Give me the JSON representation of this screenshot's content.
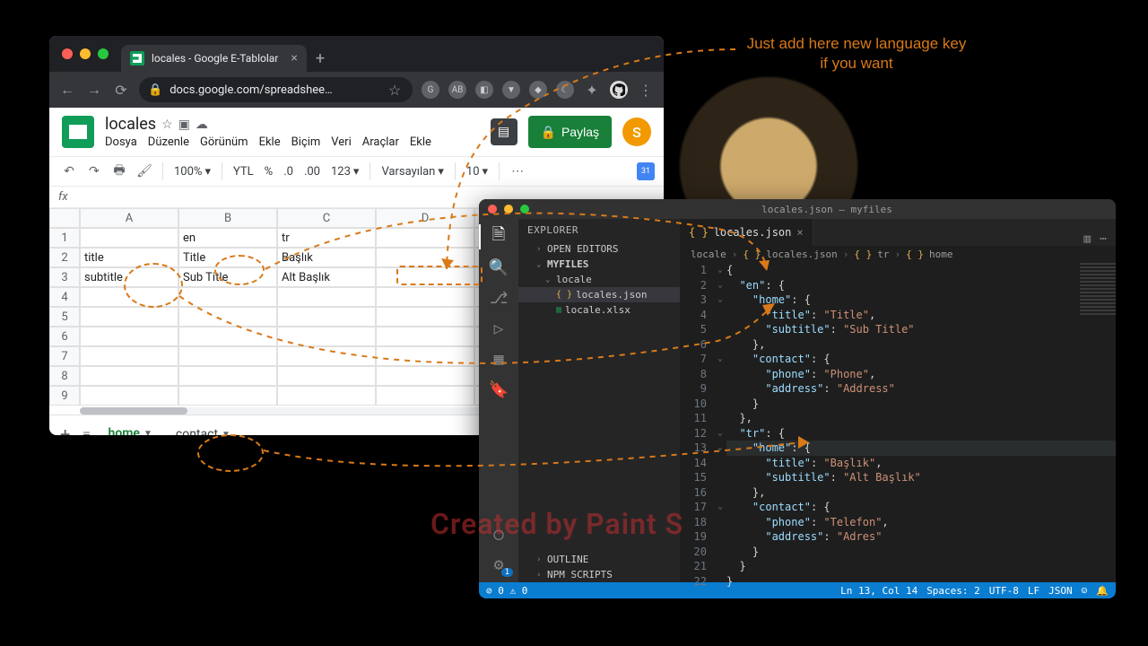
{
  "annotation": {
    "line1": "Just add here new language key",
    "line2": "if you want"
  },
  "watermark": "Created by Paint S",
  "chrome": {
    "tab_title": "locales - Google E-Tablolar",
    "url": "docs.google.com/spreadshee…"
  },
  "sheets": {
    "doc_title": "locales",
    "menus": [
      "Dosya",
      "Düzenle",
      "Görünüm",
      "Ekle",
      "Biçim",
      "Veri",
      "Araçlar",
      "Ekle"
    ],
    "share_label": "Paylaş",
    "avatar_letter": "S",
    "toolbar": {
      "zoom": "100%",
      "currency": "YTL",
      "percent": "%",
      "dec_dec": ".0",
      "dec_inc": ".00",
      "numfmt": "123",
      "font": "Varsayılan",
      "size": "10"
    },
    "columns": [
      "A",
      "B",
      "C",
      "D"
    ],
    "rows": [
      "1",
      "2",
      "3",
      "4",
      "5",
      "6",
      "7",
      "8",
      "9"
    ],
    "data": [
      [
        "",
        "en",
        "tr",
        ""
      ],
      [
        "title",
        "Title",
        "Başlık",
        ""
      ],
      [
        "subtitle",
        "Sub Title",
        "Alt Başlık",
        ""
      ]
    ],
    "tabs": {
      "active": "home",
      "other": "contact"
    },
    "cal_day": "31"
  },
  "vscode": {
    "title": "locales.json — myfiles",
    "explorer": {
      "header": "EXPLORER",
      "open_editors": "OPEN EDITORS",
      "workspace": "MYFILES",
      "folder": "locale",
      "file_json": "locales.json",
      "file_xlsx": "locale.xlsx",
      "outline": "OUTLINE",
      "npm": "NPM SCRIPTS"
    },
    "tab": "locales.json",
    "breadcrumbs": [
      "locale",
      "locales.json",
      "tr",
      "home"
    ],
    "code_lines": [
      "{",
      "  \"en\": {",
      "    \"home\": {",
      "      \"title\": \"Title\",",
      "      \"subtitle\": \"Sub Title\"",
      "    },",
      "    \"contact\": {",
      "      \"phone\": \"Phone\",",
      "      \"address\": \"Address\"",
      "    }",
      "  },",
      "  \"tr\": {",
      "    \"home\": {",
      "      \"title\": \"Başlık\",",
      "      \"subtitle\": \"Alt Başlık\"",
      "    },",
      "    \"contact\": {",
      "      \"phone\": \"Telefon\",",
      "      \"address\": \"Adres\"",
      "    }",
      "  }",
      "}"
    ],
    "status": {
      "errors": "0",
      "warnings": "0",
      "cursor": "Ln 13, Col 14",
      "spaces": "Spaces: 2",
      "enc": "UTF-8",
      "eol": "LF",
      "lang": "JSON"
    }
  }
}
